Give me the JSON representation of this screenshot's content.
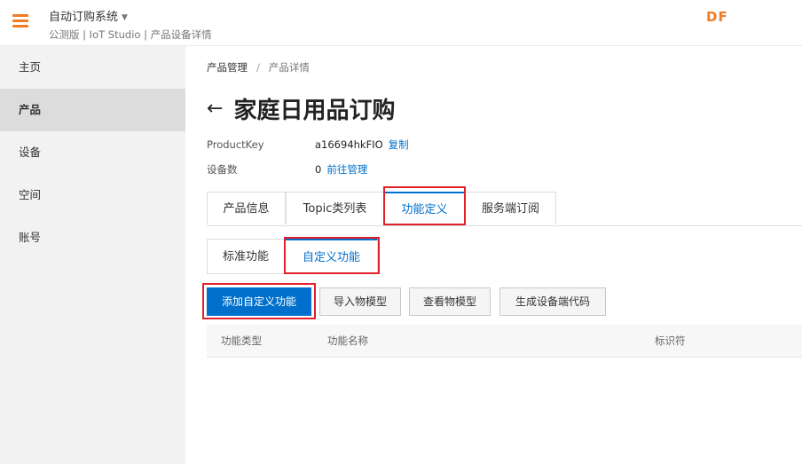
{
  "header": {
    "app_title": "自动订购系统",
    "app_sub": "公测版 | IoT Studio | 产品设备详情",
    "logo": "DF",
    "accent_color": "#f07c24"
  },
  "sidebar": {
    "items": [
      {
        "label": "主页"
      },
      {
        "label": "产品"
      },
      {
        "label": "设备"
      },
      {
        "label": "空间"
      },
      {
        "label": "账号"
      }
    ],
    "active_index": 1
  },
  "breadcrumb": {
    "root": "产品管理",
    "separator": "/",
    "current": "产品详情"
  },
  "page": {
    "title": "家庭日用品订购"
  },
  "info": {
    "product_key_label": "ProductKey",
    "product_key_value": "a16694hkFIO",
    "copy_link": "复制",
    "device_count_label": "设备数",
    "device_count_value": "0",
    "manage_link": "前往管理"
  },
  "tabs": [
    {
      "label": "产品信息"
    },
    {
      "label": "Topic类列表"
    },
    {
      "label": "功能定义"
    },
    {
      "label": "服务端订阅"
    }
  ],
  "active_tab": "功能定义",
  "subtabs": [
    {
      "label": "标准功能"
    },
    {
      "label": "自定义功能"
    }
  ],
  "active_subtab": "自定义功能",
  "actions": {
    "add_custom": "添加自定义功能",
    "import_model": "导入物模型",
    "view_model": "查看物模型",
    "gen_code": "生成设备端代码"
  },
  "table": {
    "columns": [
      "功能类型",
      "功能名称",
      "标识符"
    ]
  },
  "colors": {
    "primary": "#0070cc",
    "highlight": "#e0212b"
  }
}
